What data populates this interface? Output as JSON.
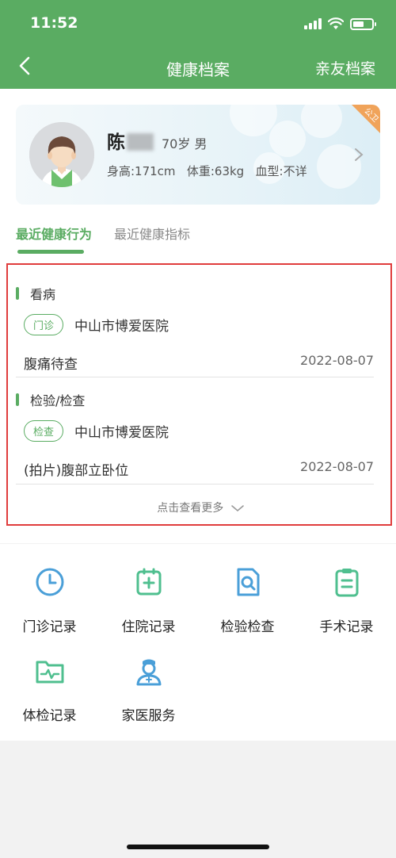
{
  "status": {
    "time": "11:52"
  },
  "nav": {
    "title": "健康档案",
    "right": "亲友档案"
  },
  "profile": {
    "name": "陈",
    "age_gender": "70岁 男",
    "height": "身高:171cm",
    "weight": "体重:63kg",
    "blood": "血型:不详",
    "corner": "公卫"
  },
  "tabs": [
    "最近健康行为",
    "最近健康指标"
  ],
  "records": [
    {
      "type": "看病",
      "badge": "门诊",
      "org": "中山市博爱医院",
      "desc": "腹痛待查",
      "date": "2022-08-07"
    },
    {
      "type": "检验/检查",
      "badge": "检查",
      "org": "中山市博爱医院",
      "desc": "(拍片)腹部立卧位",
      "date": "2022-08-07"
    }
  ],
  "more": "点击查看更多",
  "services": [
    {
      "label": "门诊记录",
      "icon": "clock-icon"
    },
    {
      "label": "住院记录",
      "icon": "hospital-plus-icon"
    },
    {
      "label": "检验检查",
      "icon": "document-search-icon"
    },
    {
      "label": "手术记录",
      "icon": "clipboard-icon"
    },
    {
      "label": "体检记录",
      "icon": "folder-pulse-icon"
    },
    {
      "label": "家医服务",
      "icon": "doctor-icon"
    }
  ],
  "colors": {
    "primary": "#5aac62",
    "highlight": "#e03c3c",
    "icon_blue": "#4a9fd8"
  }
}
